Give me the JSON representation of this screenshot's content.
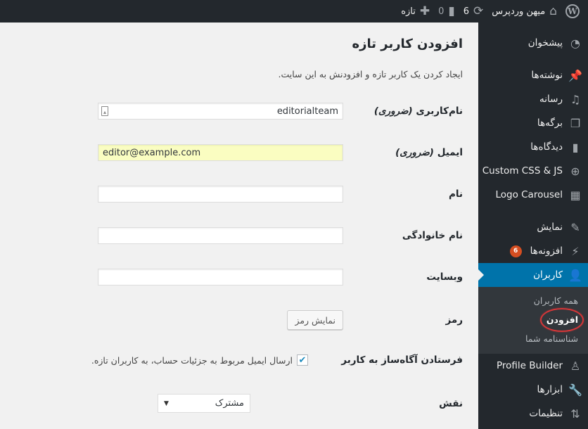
{
  "adminbar": {
    "wp_logo_icon": "wordpress-logo-icon",
    "site_name": "میهن وردپرس",
    "site_icon": "home-icon",
    "updates_count": "6",
    "updates_icon": "updates-icon",
    "comments_count": "0",
    "comments_icon": "comment-icon",
    "new_label": "تازه",
    "new_icon": "plus-icon"
  },
  "sidebar": {
    "items": [
      {
        "label": "پیشخوان",
        "icon": "dashboard-icon"
      },
      {
        "label": "نوشته‌ها",
        "icon": "pin-icon"
      },
      {
        "label": "رسانه",
        "icon": "media-icon"
      },
      {
        "label": "برگه‌ها",
        "icon": "pages-icon"
      },
      {
        "label": "دیدگاه‌ها",
        "icon": "comment-icon"
      },
      {
        "label": "Custom CSS & JS",
        "icon": "plus-circle-icon"
      },
      {
        "label": "Logo Carousel",
        "icon": "gallery-icon"
      },
      {
        "label": "نمایش",
        "icon": "brush-icon"
      },
      {
        "label": "افزونه‌ها",
        "icon": "plugin-icon",
        "badge": "6"
      },
      {
        "label": "کاربران",
        "icon": "user-icon",
        "current": true
      },
      {
        "label": "Profile Builder",
        "icon": "user-outline-icon"
      },
      {
        "label": "ابزارها",
        "icon": "wrench-icon"
      },
      {
        "label": "تنظیمات",
        "icon": "settings-icon"
      }
    ],
    "users_submenu": [
      "همه کاربران",
      "افزودن",
      "شناسنامه شما"
    ]
  },
  "main": {
    "title": "افزودن کاربر تازه",
    "description": "ایجاد کردن یک کاربر تازه و افزودنش به این سایت.",
    "fields": {
      "username": {
        "label": "نام‌کاربری",
        "required": "(ضروری)",
        "value": "editorialteam"
      },
      "email": {
        "label": "ایمیل",
        "required": "(ضروری)",
        "value": "editor@example.com"
      },
      "first_name": {
        "label": "نام",
        "value": ""
      },
      "last_name": {
        "label": "نام خانوادگی",
        "value": ""
      },
      "website": {
        "label": "وبسایت",
        "value": ""
      },
      "password": {
        "label": "رمز",
        "button": "نمایش رمز"
      },
      "notify": {
        "label": "فرستادن آگاه‌ساز به کاربر",
        "checked": true,
        "text": "ارسال ایمیل مربوط به جزئیات حساب، به کاربران تازه."
      },
      "role": {
        "label": "نقش",
        "value": "مشترک"
      }
    }
  }
}
